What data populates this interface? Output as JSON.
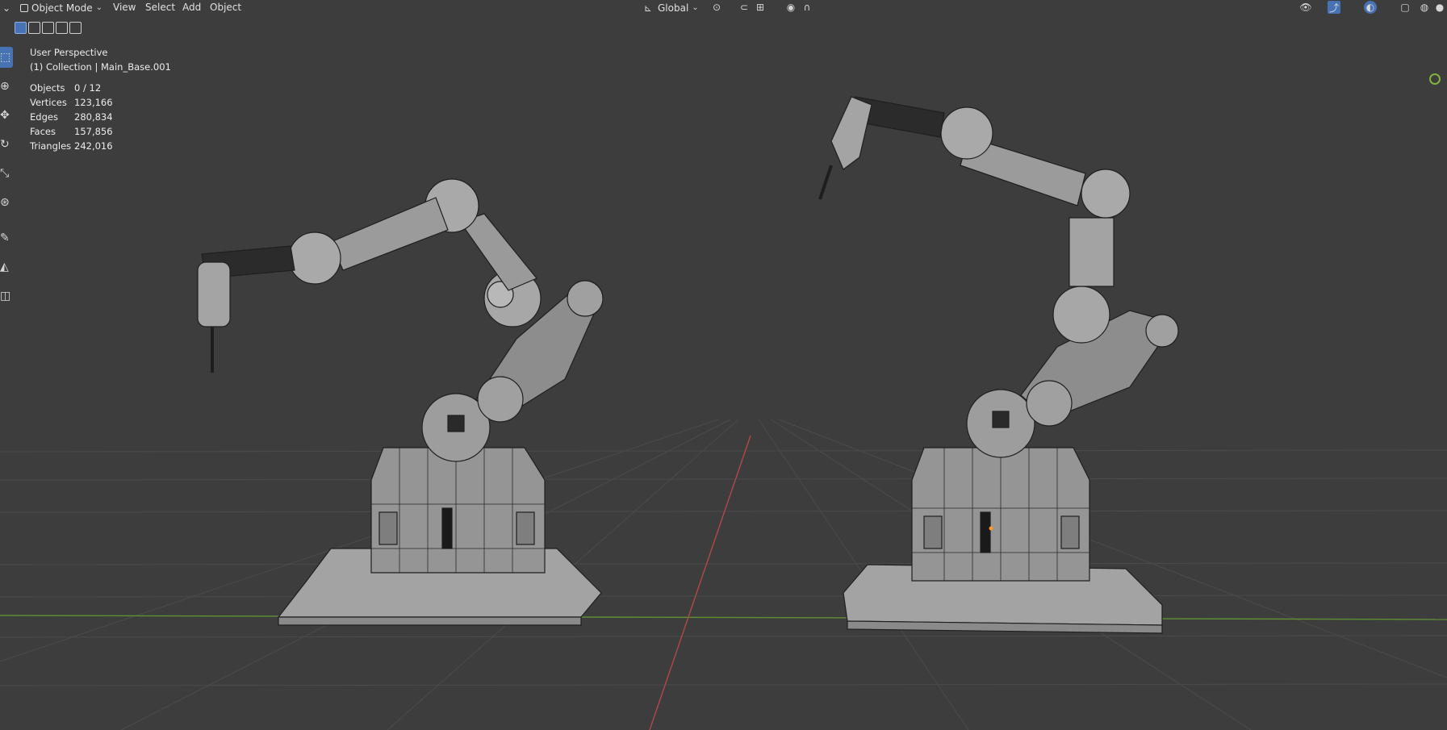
{
  "header": {
    "mode": "Object Mode",
    "menus": [
      "View",
      "Select",
      "Add",
      "Object"
    ],
    "transform_orientation": "Global"
  },
  "overlay": {
    "view_name": "User Perspective",
    "collection": "(1) Collection | Main_Base.001",
    "stats": [
      {
        "label": "Objects",
        "value": "0 / 12"
      },
      {
        "label": "Vertices",
        "value": "123,166"
      },
      {
        "label": "Edges",
        "value": "280,834"
      },
      {
        "label": "Faces",
        "value": "157,856"
      },
      {
        "label": "Triangles",
        "value": "242,016"
      }
    ]
  },
  "toolbar": {
    "tools": [
      "select-box-icon",
      "cursor-icon",
      "move-icon",
      "rotate-icon",
      "scale-icon",
      "transform-icon",
      "annotate-icon",
      "measure-icon",
      "add-cube-icon"
    ]
  },
  "colors": {
    "background": "#3d3d3d",
    "grid": "#4a4a4a",
    "x_axis": "#b34848",
    "y_axis": "#6aa03a",
    "selection_accent": "#4772b3",
    "mesh_fill": "#9a9a9a",
    "wire": "#222222"
  }
}
